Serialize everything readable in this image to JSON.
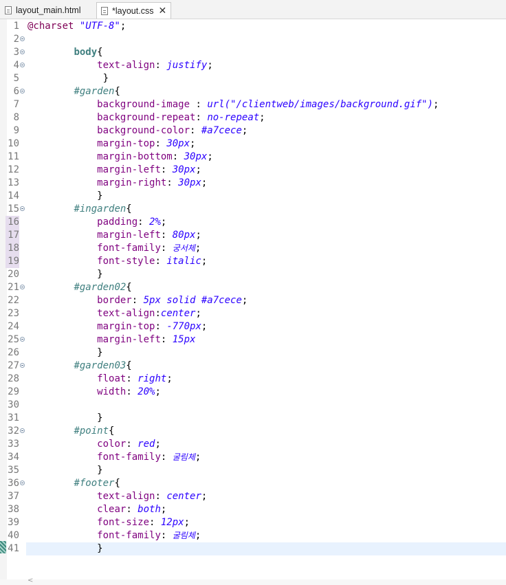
{
  "tabs": [
    {
      "label": "layout_main.html",
      "active": false
    },
    {
      "label": "*layout.css",
      "active": true
    }
  ],
  "editor": {
    "lines": [
      {
        "n": "1",
        "fold": false,
        "changed": false,
        "segments": [
          [
            "kw",
            "@charset "
          ],
          [
            "str",
            "\"UTF-8\""
          ],
          [
            "p",
            ";"
          ]
        ]
      },
      {
        "n": "2",
        "fold": true,
        "changed": false,
        "segments": []
      },
      {
        "n": "3",
        "fold": true,
        "changed": false,
        "segments": [
          [
            "p",
            "        "
          ],
          [
            "tag",
            "body"
          ],
          [
            "p",
            "{"
          ]
        ]
      },
      {
        "n": "4",
        "fold": true,
        "changed": false,
        "segments": [
          [
            "p",
            "            "
          ],
          [
            "prop",
            "text-align"
          ],
          [
            "p",
            ": "
          ],
          [
            "val",
            "justify"
          ],
          [
            "p",
            ";"
          ]
        ]
      },
      {
        "n": "5",
        "fold": false,
        "changed": false,
        "segments": [
          [
            "p",
            "             }"
          ]
        ]
      },
      {
        "n": "6",
        "fold": true,
        "changed": false,
        "segments": [
          [
            "p",
            "        "
          ],
          [
            "sel",
            "#garden"
          ],
          [
            "p",
            "{"
          ]
        ]
      },
      {
        "n": "7",
        "fold": false,
        "changed": false,
        "segments": [
          [
            "p",
            "            "
          ],
          [
            "prop",
            "background-image"
          ],
          [
            "p",
            " : "
          ],
          [
            "val",
            "url(\"/clientweb/images/background.gif\")"
          ],
          [
            "p",
            ";"
          ]
        ]
      },
      {
        "n": "8",
        "fold": false,
        "changed": false,
        "segments": [
          [
            "p",
            "            "
          ],
          [
            "prop",
            "background-repeat"
          ],
          [
            "p",
            ": "
          ],
          [
            "val",
            "no-repeat"
          ],
          [
            "p",
            ";"
          ]
        ]
      },
      {
        "n": "9",
        "fold": false,
        "changed": false,
        "segments": [
          [
            "p",
            "            "
          ],
          [
            "prop",
            "background-color"
          ],
          [
            "p",
            ": "
          ],
          [
            "val",
            "#a7cece"
          ],
          [
            "p",
            ";"
          ]
        ]
      },
      {
        "n": "10",
        "fold": false,
        "changed": false,
        "segments": [
          [
            "p",
            "            "
          ],
          [
            "prop",
            "margin-top"
          ],
          [
            "p",
            ": "
          ],
          [
            "val",
            "30px"
          ],
          [
            "p",
            ";"
          ]
        ]
      },
      {
        "n": "11",
        "fold": false,
        "changed": false,
        "segments": [
          [
            "p",
            "            "
          ],
          [
            "prop",
            "margin-bottom"
          ],
          [
            "p",
            ": "
          ],
          [
            "val",
            "30px"
          ],
          [
            "p",
            ";"
          ]
        ]
      },
      {
        "n": "12",
        "fold": false,
        "changed": false,
        "segments": [
          [
            "p",
            "            "
          ],
          [
            "prop",
            "margin-left"
          ],
          [
            "p",
            ": "
          ],
          [
            "val",
            "30px"
          ],
          [
            "p",
            ";"
          ]
        ]
      },
      {
        "n": "13",
        "fold": false,
        "changed": false,
        "segments": [
          [
            "p",
            "            "
          ],
          [
            "prop",
            "margin-right"
          ],
          [
            "p",
            ": "
          ],
          [
            "val",
            "30px"
          ],
          [
            "p",
            ";"
          ]
        ]
      },
      {
        "n": "14",
        "fold": false,
        "changed": false,
        "segments": [
          [
            "p",
            "            }"
          ]
        ]
      },
      {
        "n": "15",
        "fold": true,
        "changed": false,
        "segments": [
          [
            "p",
            "        "
          ],
          [
            "sel",
            "#ingarden"
          ],
          [
            "p",
            "{"
          ]
        ]
      },
      {
        "n": "16",
        "fold": false,
        "changed": true,
        "segments": [
          [
            "p",
            "            "
          ],
          [
            "prop",
            "padding"
          ],
          [
            "p",
            ": "
          ],
          [
            "val",
            "2%"
          ],
          [
            "p",
            ";"
          ]
        ]
      },
      {
        "n": "17",
        "fold": false,
        "changed": true,
        "segments": [
          [
            "p",
            "            "
          ],
          [
            "prop",
            "margin-left"
          ],
          [
            "p",
            ": "
          ],
          [
            "val",
            "80px"
          ],
          [
            "p",
            ";"
          ]
        ]
      },
      {
        "n": "18",
        "fold": false,
        "changed": true,
        "segments": [
          [
            "p",
            "            "
          ],
          [
            "prop",
            "font-family"
          ],
          [
            "p",
            ": "
          ],
          [
            "valko",
            "궁서체"
          ],
          [
            "p",
            ";"
          ]
        ]
      },
      {
        "n": "19",
        "fold": false,
        "changed": true,
        "segments": [
          [
            "p",
            "            "
          ],
          [
            "prop",
            "font-style"
          ],
          [
            "p",
            ": "
          ],
          [
            "val",
            "italic"
          ],
          [
            "p",
            ";"
          ]
        ]
      },
      {
        "n": "20",
        "fold": false,
        "changed": false,
        "segments": [
          [
            "p",
            "            }"
          ]
        ]
      },
      {
        "n": "21",
        "fold": true,
        "changed": false,
        "segments": [
          [
            "p",
            "        "
          ],
          [
            "sel",
            "#garden02"
          ],
          [
            "p",
            "{"
          ]
        ]
      },
      {
        "n": "22",
        "fold": false,
        "changed": false,
        "segments": [
          [
            "p",
            "            "
          ],
          [
            "prop",
            "border"
          ],
          [
            "p",
            ": "
          ],
          [
            "val",
            "5px solid #a7cece"
          ],
          [
            "p",
            ";"
          ]
        ]
      },
      {
        "n": "23",
        "fold": false,
        "changed": false,
        "segments": [
          [
            "p",
            "            "
          ],
          [
            "prop",
            "text-align"
          ],
          [
            "p",
            ":"
          ],
          [
            "val",
            "center"
          ],
          [
            "p",
            ";"
          ]
        ]
      },
      {
        "n": "24",
        "fold": false,
        "changed": false,
        "segments": [
          [
            "p",
            "            "
          ],
          [
            "prop",
            "margin-top"
          ],
          [
            "p",
            ": "
          ],
          [
            "val",
            "-770px"
          ],
          [
            "p",
            ";"
          ]
        ]
      },
      {
        "n": "25",
        "fold": true,
        "changed": false,
        "segments": [
          [
            "p",
            "            "
          ],
          [
            "prop",
            "margin-left"
          ],
          [
            "p",
            ": "
          ],
          [
            "val",
            "15px"
          ]
        ]
      },
      {
        "n": "26",
        "fold": false,
        "changed": false,
        "segments": [
          [
            "p",
            "            }"
          ]
        ]
      },
      {
        "n": "27",
        "fold": true,
        "changed": false,
        "segments": [
          [
            "p",
            "        "
          ],
          [
            "sel",
            "#garden03"
          ],
          [
            "p",
            "{"
          ]
        ]
      },
      {
        "n": "28",
        "fold": false,
        "changed": false,
        "segments": [
          [
            "p",
            "            "
          ],
          [
            "prop",
            "float"
          ],
          [
            "p",
            ": "
          ],
          [
            "val",
            "right"
          ],
          [
            "p",
            ";"
          ]
        ]
      },
      {
        "n": "29",
        "fold": false,
        "changed": false,
        "segments": [
          [
            "p",
            "            "
          ],
          [
            "prop",
            "width"
          ],
          [
            "p",
            ": "
          ],
          [
            "val",
            "20%"
          ],
          [
            "p",
            ";"
          ]
        ]
      },
      {
        "n": "30",
        "fold": false,
        "changed": false,
        "segments": []
      },
      {
        "n": "31",
        "fold": false,
        "changed": false,
        "segments": [
          [
            "p",
            "            }"
          ]
        ]
      },
      {
        "n": "32",
        "fold": true,
        "changed": false,
        "segments": [
          [
            "p",
            "        "
          ],
          [
            "sel",
            "#point"
          ],
          [
            "p",
            "{"
          ]
        ]
      },
      {
        "n": "33",
        "fold": false,
        "changed": false,
        "segments": [
          [
            "p",
            "            "
          ],
          [
            "prop",
            "color"
          ],
          [
            "p",
            ": "
          ],
          [
            "val",
            "red"
          ],
          [
            "p",
            ";"
          ]
        ]
      },
      {
        "n": "34",
        "fold": false,
        "changed": false,
        "segments": [
          [
            "p",
            "            "
          ],
          [
            "prop",
            "font-family"
          ],
          [
            "p",
            ": "
          ],
          [
            "valko",
            "굴림체"
          ],
          [
            "p",
            ";"
          ]
        ]
      },
      {
        "n": "35",
        "fold": false,
        "changed": false,
        "segments": [
          [
            "p",
            "            }"
          ]
        ]
      },
      {
        "n": "36",
        "fold": true,
        "changed": false,
        "segments": [
          [
            "p",
            "        "
          ],
          [
            "sel",
            "#footer"
          ],
          [
            "p",
            "{"
          ]
        ]
      },
      {
        "n": "37",
        "fold": false,
        "changed": false,
        "segments": [
          [
            "p",
            "            "
          ],
          [
            "prop",
            "text-align"
          ],
          [
            "p",
            ": "
          ],
          [
            "val",
            "center"
          ],
          [
            "p",
            ";"
          ]
        ]
      },
      {
        "n": "38",
        "fold": false,
        "changed": false,
        "segments": [
          [
            "p",
            "            "
          ],
          [
            "prop",
            "clear"
          ],
          [
            "p",
            ": "
          ],
          [
            "val",
            "both"
          ],
          [
            "p",
            ";"
          ]
        ]
      },
      {
        "n": "39",
        "fold": false,
        "changed": false,
        "segments": [
          [
            "p",
            "            "
          ],
          [
            "prop",
            "font-size"
          ],
          [
            "p",
            ": "
          ],
          [
            "val",
            "12px"
          ],
          [
            "p",
            ";"
          ]
        ]
      },
      {
        "n": "40",
        "fold": false,
        "changed": false,
        "segments": [
          [
            "p",
            "            "
          ],
          [
            "prop",
            "font-family"
          ],
          [
            "p",
            ": "
          ],
          [
            "valko",
            "굴림체"
          ],
          [
            "p",
            ";"
          ]
        ]
      },
      {
        "n": "41",
        "fold": false,
        "changed": false,
        "current": true,
        "segments": [
          [
            "p",
            "            }"
          ]
        ]
      }
    ]
  },
  "icons": {
    "tab_file": "file-icon",
    "tab_close": "close-icon",
    "fold": "fold-collapse-icon",
    "scroll_left": "scroll-left-arrow-icon"
  },
  "scroll": {
    "left_arrow": "<"
  }
}
